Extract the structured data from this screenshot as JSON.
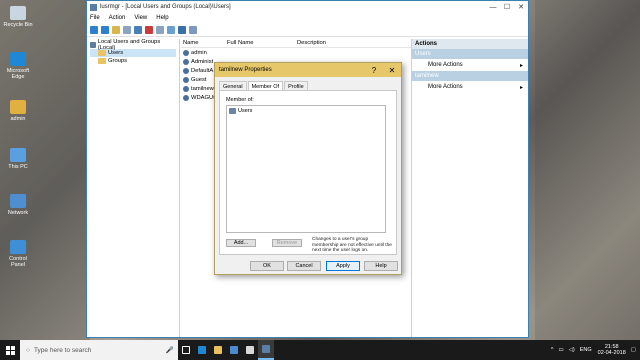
{
  "desktop": {
    "icons": [
      {
        "label": "Recycle Bin",
        "color": "#c9d6e2"
      },
      {
        "label": "Microsoft Edge",
        "color": "#1e88d6"
      },
      {
        "label": "admin",
        "color": "#e0b040"
      },
      {
        "label": "This PC",
        "color": "#5aa0e0"
      },
      {
        "label": "Network",
        "color": "#4d8fd0"
      },
      {
        "label": "Control Panel",
        "color": "#3f8fd8"
      }
    ]
  },
  "mmc": {
    "title": "lusrmgr - [Local Users and Groups (Local)\\Users]",
    "menu": [
      "File",
      "Action",
      "View",
      "Help"
    ],
    "tree": {
      "root": "Local Users and Groups (Local)",
      "children": [
        "Users",
        "Groups"
      ]
    },
    "list": {
      "columns": [
        "Name",
        "Full Name",
        "Description"
      ],
      "rows": [
        "admin",
        "Administ",
        "DefaultA",
        "Guest",
        "tamilnew",
        "WDAGUtil"
      ]
    },
    "actions": {
      "header": "Actions",
      "section1": "Users",
      "item1": "More Actions",
      "section2": "tamilnew",
      "item2": "More Actions"
    }
  },
  "dialog": {
    "title": "tamilnew Properties",
    "help_btn": "?",
    "close_btn": "✕",
    "tabs": [
      "General",
      "Member Of",
      "Profile"
    ],
    "member_of_label": "Member of:",
    "members": [
      "Users"
    ],
    "add_btn": "Add...",
    "remove_btn": "Remove",
    "note": "Changes to a user's group membership are not effective until the next time the user logs on.",
    "ok": "OK",
    "cancel": "Cancel",
    "apply": "Apply",
    "help": "Help"
  },
  "taskbar": {
    "search_placeholder": "Type here to search",
    "lang": "ENG",
    "time": "21:58",
    "date": "02-04-2018"
  }
}
